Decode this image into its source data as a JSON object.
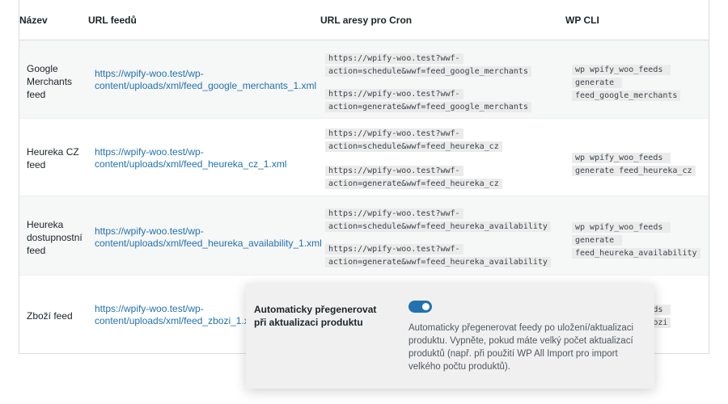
{
  "table": {
    "headers": {
      "name": "Název",
      "feed_url": "URL feedů",
      "cron_url": "URL aresy pro Cron",
      "cli": "WP CLI"
    },
    "rows": [
      {
        "name": "Google Merchants feed",
        "feed_url": "https://wpify-woo.test/wp-content/uploads/xml/feed_google_merchants_1.xml",
        "cron_schedule": "https://wpify-woo.test?wwf-action=schedule&wwf=feed_google_merchants",
        "cron_generate": "https://wpify-woo.test?wwf-action=generate&wwf=feed_google_merchants",
        "cli": "wp wpify_woo_feeds generate feed_google_merchants"
      },
      {
        "name": "Heureka CZ feed",
        "feed_url": "https://wpify-woo.test/wp-content/uploads/xml/feed_heureka_cz_1.xml",
        "cron_schedule": "https://wpify-woo.test?wwf-action=schedule&wwf=feed_heureka_cz",
        "cron_generate": "https://wpify-woo.test?wwf-action=generate&wwf=feed_heureka_cz",
        "cli": "wp wpify_woo_feeds generate feed_heureka_cz"
      },
      {
        "name": "Heureka dostupnostní feed",
        "feed_url": "https://wpify-woo.test/wp-content/uploads/xml/feed_heureka_availability_1.xml",
        "cron_schedule": "https://wpify-woo.test?wwf-action=schedule&wwf=feed_heureka_availability",
        "cron_generate": "https://wpify-woo.test?wwf-action=generate&wwf=feed_heureka_availability",
        "cli": "wp wpify_woo_feeds generate feed_heureka_availability"
      },
      {
        "name": "Zboží feed",
        "feed_url": "https://wpify-woo.test/wp-content/uploads/xml/feed_zbozi_1.xml",
        "cli": "wp wpify_woo_feeds generate feed_zbozi"
      }
    ]
  },
  "setting": {
    "label": "Automaticky přegenerovat při aktualizaci produktu",
    "toggle_on": true,
    "description": "Automaticky přegenerovat feedy po uložení/aktualizaci produktu. Vypněte, pokud máte velký počet aktualizací produktů (např. při použití WP All Import pro import velkého počtu produktů).",
    "accent_color": "#2271b1"
  }
}
